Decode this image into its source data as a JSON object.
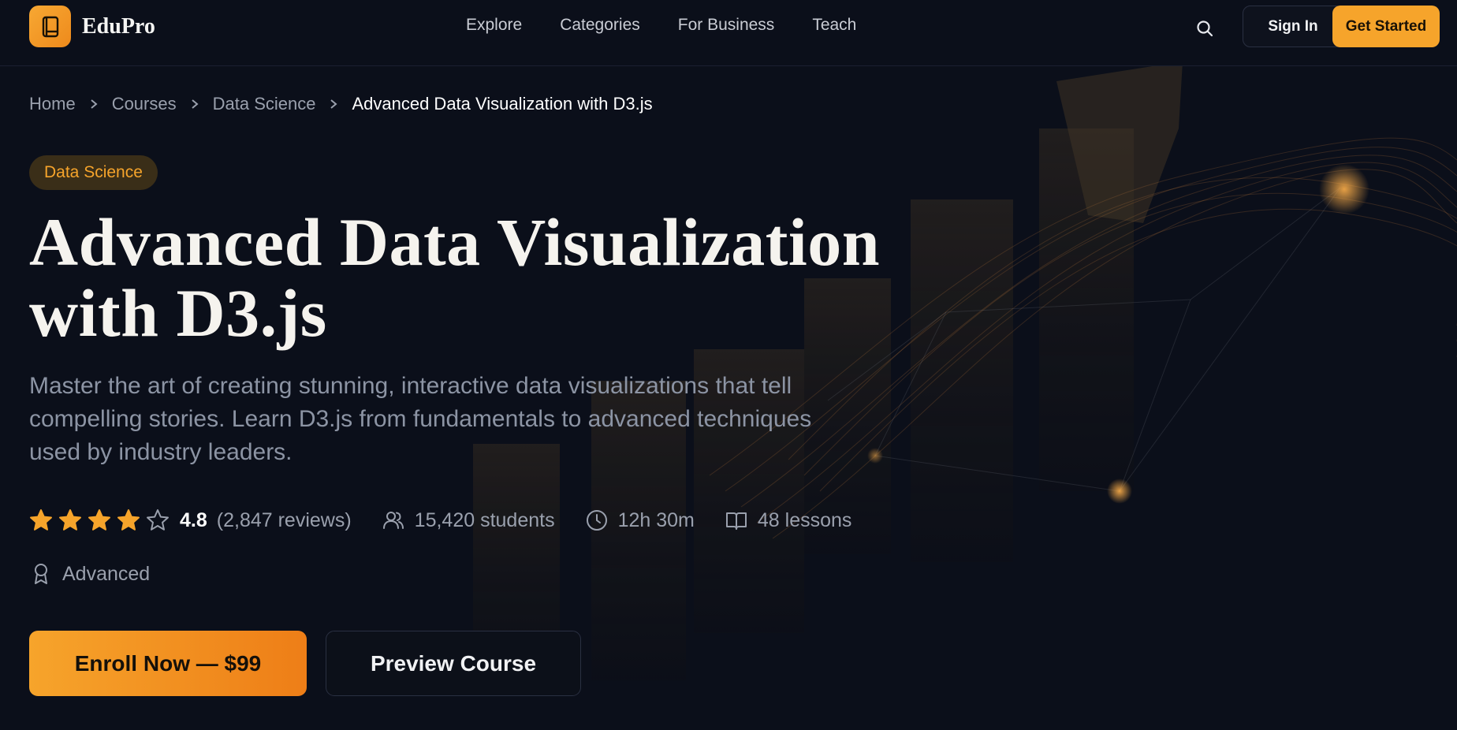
{
  "brand": {
    "name": "EduPro",
    "logo_icon": "book-icon"
  },
  "nav": {
    "links": [
      "Explore",
      "Categories",
      "For Business",
      "Teach"
    ]
  },
  "header_actions": {
    "search_icon": "search-icon",
    "sign_in": "Sign In",
    "get_started": "Get Started"
  },
  "breadcrumb": [
    "Home",
    "Courses",
    "Data Science",
    "Advanced Data Visualization with D3.js"
  ],
  "course": {
    "category": "Data Science",
    "title_line1": "Advanced Data Visualization",
    "title_line2": "with D3.js",
    "description": "Master the art of creating stunning, interactive data visualizations that tell compelling stories. Learn D3.js from fundamentals to advanced techniques used by industry leaders.",
    "rating": "4.8",
    "rating_stars_filled": 4,
    "rating_stars_total": 5,
    "reviews": "(2,847 reviews)",
    "students": "15,420 students",
    "duration": "12h 30m",
    "lessons": "48 lessons",
    "level": "Advanced"
  },
  "cta": {
    "enroll": "Enroll Now — $99",
    "preview": "Preview Course"
  },
  "colors": {
    "accent": "#f6a42b",
    "background": "#0b0f1a",
    "text_muted": "#9aa0ad"
  }
}
